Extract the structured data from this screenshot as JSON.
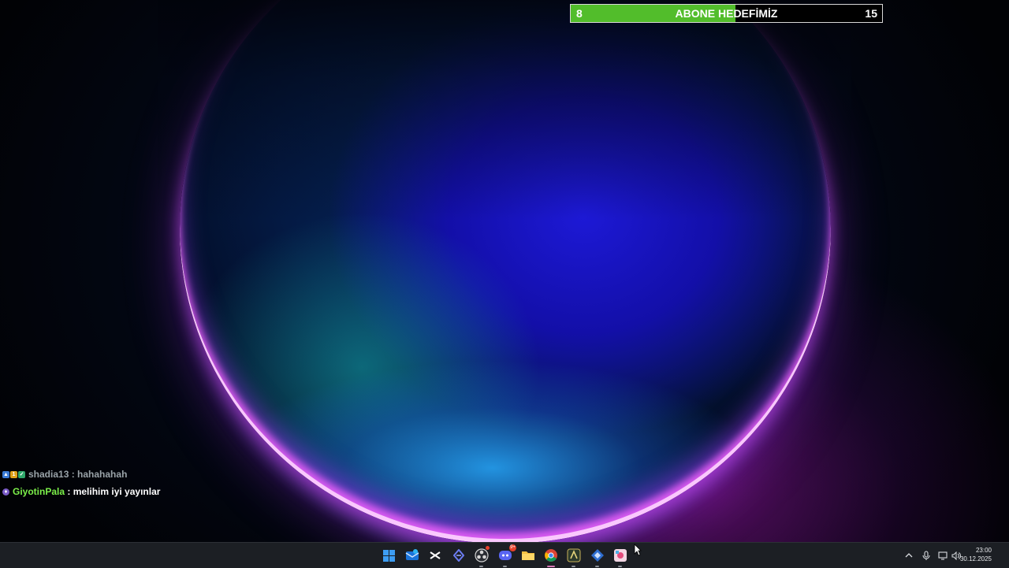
{
  "goal_widget": {
    "title": "ABONE HEDEFİMİZ",
    "current": "8",
    "target": "15",
    "progress_fraction": 0.53,
    "fill_color": "#52bd2b"
  },
  "chat": {
    "messages": [
      {
        "user": "shadia13",
        "separator": " : ",
        "text": "hahahahah",
        "user_color": "#9aa3a8",
        "badges": [
          "broadcaster-icon",
          "founder-icon",
          "partner-icon"
        ]
      },
      {
        "user": "GiyotinPala",
        "separator": " : ",
        "text": "melihim iyi yayınlar",
        "user_color": "#7cf04a",
        "badges": [
          "subscriber-icon"
        ]
      }
    ]
  },
  "taskbar": {
    "apps": [
      {
        "name": "start-button-icon"
      },
      {
        "name": "mail-app-icon"
      },
      {
        "name": "capcut-icon"
      },
      {
        "name": "sidequest-icon"
      },
      {
        "name": "obs-studio-icon"
      },
      {
        "name": "discord-icon",
        "badge": "9+"
      },
      {
        "name": "file-explorer-icon"
      },
      {
        "name": "chrome-icon"
      },
      {
        "name": "streamlabs-icon"
      },
      {
        "name": "network-app-icon"
      },
      {
        "name": "stream-app-icon"
      }
    ],
    "tray": {
      "icons": [
        "chevron-up-icon",
        "microphone-icon",
        "display-icon",
        "volume-icon"
      ],
      "time": "23:00",
      "date": "30.12.2025"
    }
  }
}
